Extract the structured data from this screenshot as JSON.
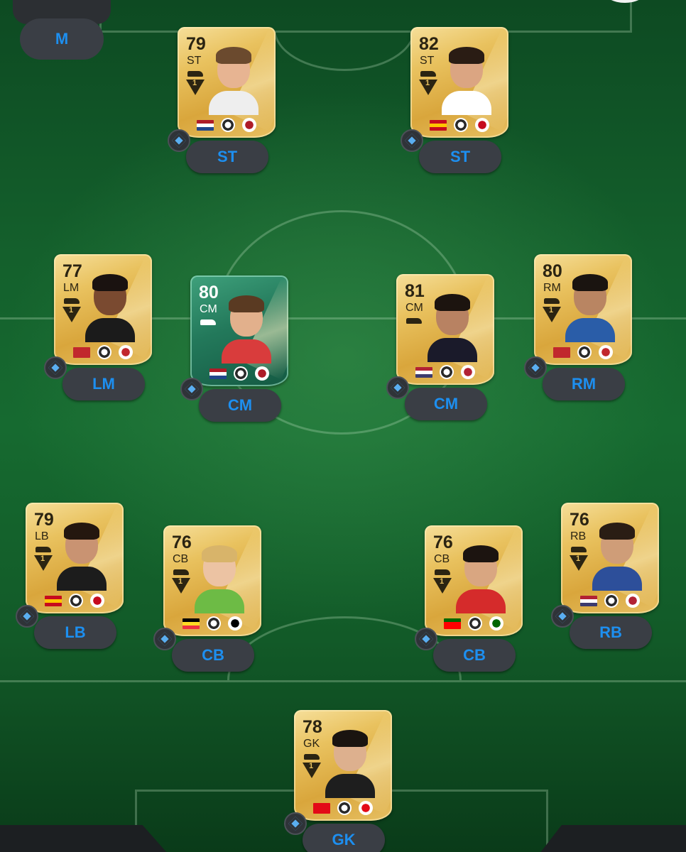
{
  "top_left_slot": {
    "position": "M"
  },
  "players": [
    {
      "key": "st1",
      "rating": "79",
      "card_position": "ST",
      "slot_label": "ST",
      "chemistry": "1",
      "nation_flag": "netherlands-flag",
      "league": "eredivisie-logo",
      "club": "psv-logo",
      "colors": [
        "#ae1c28",
        "#ffffff",
        "#21468b"
      ],
      "skin": "#e7b492",
      "hair": "#6b4a2e",
      "kit": "#eeeeee"
    },
    {
      "key": "st2",
      "rating": "82",
      "card_position": "ST",
      "slot_label": "ST",
      "chemistry": "1",
      "nation_flag": "spain-flag",
      "league": "liga-f-logo",
      "club": "levante-logo",
      "colors": [
        "#c60b1e",
        "#ffc400",
        "#c60b1e"
      ],
      "skin": "#dba582",
      "hair": "#2a1c14",
      "kit": "#ffffff"
    },
    {
      "key": "lm",
      "rating": "77",
      "card_position": "LM",
      "slot_label": "LM",
      "chemistry": "1",
      "nation_flag": "morocco-flag",
      "league": "bundesliga-logo",
      "club": "leverkusen-logo",
      "colors": [
        "#c1272d",
        "#c1272d",
        "#c1272d"
      ],
      "skin": "#7a4a30",
      "hair": "#1a1210",
      "kit": "#1b1b1b"
    },
    {
      "key": "cm1",
      "rating": "80",
      "card_position": "CM",
      "slot_label": "CM",
      "chemistry": "",
      "nation_flag": "netherlands-flag",
      "league": "eredivisie-logo",
      "club": "pec-zwolle-logo",
      "colors": [
        "#ae1c28",
        "#ffffff",
        "#21468b"
      ],
      "skin": "#e2b08c",
      "hair": "#5a3a22",
      "kit": "#d93c3c",
      "special": true
    },
    {
      "key": "cm2",
      "rating": "81",
      "card_position": "CM",
      "slot_label": "CM",
      "chemistry": "",
      "nation_flag": "usa-flag",
      "league": "nwsl-logo",
      "club": "san-diego-wave-logo",
      "colors": [
        "#b22234",
        "#ffffff",
        "#3c3b6e"
      ],
      "skin": "#b88262",
      "hair": "#1c140f",
      "kit": "#1a1a2a"
    },
    {
      "key": "rm",
      "rating": "80",
      "card_position": "RM",
      "slot_label": "RM",
      "chemistry": "1",
      "nation_flag": "morocco-flag",
      "league": "trendyol-super-lig-logo",
      "club": "galatasaray-logo",
      "colors": [
        "#c1272d",
        "#c1272d",
        "#c1272d"
      ],
      "skin": "#b98562",
      "hair": "#1a1410",
      "kit": "#2a5da8"
    },
    {
      "key": "lb",
      "rating": "79",
      "card_position": "LB",
      "slot_label": "LB",
      "chemistry": "1",
      "nation_flag": "spain-flag",
      "league": "liga-f-logo",
      "club": "levante-logo",
      "colors": [
        "#c60b1e",
        "#ffc400",
        "#c60b1e"
      ],
      "skin": "#c99372",
      "hair": "#24170f",
      "kit": "#1c1c1c"
    },
    {
      "key": "cb1",
      "rating": "76",
      "card_position": "CB",
      "slot_label": "CB",
      "chemistry": "1",
      "nation_flag": "belgium-flag",
      "league": "bundesliga-logo",
      "club": "wolfsburg-logo",
      "colors": [
        "#000000",
        "#fdda24",
        "#ef3340"
      ],
      "skin": "#ecc3a3",
      "hair": "#d8b46a",
      "kit": "#6dbb45"
    },
    {
      "key": "cb2",
      "rating": "76",
      "card_position": "CB",
      "slot_label": "CB",
      "chemistry": "1",
      "nation_flag": "portugal-flag",
      "league": "bundesliga-logo",
      "club": "union-berlin-logo",
      "colors": [
        "#006600",
        "#ff0000",
        "#ff0000"
      ],
      "skin": "#d9a681",
      "hair": "#1c1410",
      "kit": "#d52b2b"
    },
    {
      "key": "rb",
      "rating": "76",
      "card_position": "RB",
      "slot_label": "RB",
      "chemistry": "1",
      "nation_flag": "usa-flag",
      "league": "eredivisie-logo",
      "club": "psv-logo",
      "colors": [
        "#b22234",
        "#ffffff",
        "#3c3b6e"
      ],
      "skin": "#cf9d78",
      "hair": "#2a1d14",
      "kit": "#2d4f9a"
    },
    {
      "key": "gk",
      "rating": "78",
      "card_position": "GK",
      "slot_label": "GK",
      "chemistry": "1",
      "nation_flag": "turkey-flag",
      "league": "trendyol-super-lig-logo",
      "club": "trabzonspor-logo",
      "colors": [
        "#e30a17",
        "#e30a17",
        "#e30a17"
      ],
      "skin": "#ddb08e",
      "hair": "#1a1410",
      "kit": "#1e1e1e"
    }
  ]
}
